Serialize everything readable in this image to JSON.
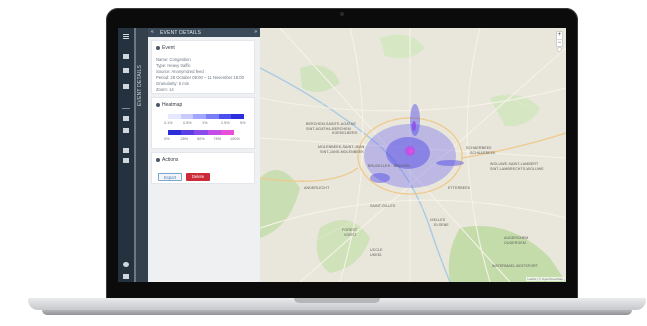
{
  "sidebar": {
    "header_title": "EVENT DETAILS",
    "back_glyph": "«",
    "close_glyph": "»",
    "vertical_label": "EVENT DETAILS"
  },
  "event_card": {
    "title": "Event",
    "rows": [
      "Name: Congestion",
      "Type: Heavy traffic",
      "Source: Anonymized feed",
      "Period: 28 October 09:00 – 11 November 18:00",
      "Granularity: 5 min",
      "Zoom: 14"
    ]
  },
  "heatmap_card": {
    "title": "Heatmap",
    "row1_labels": [
      "0.1%",
      "0.5%",
      "1%",
      "2.5%",
      "5%"
    ],
    "row2_labels": [
      "0%",
      "25%",
      "50%",
      "75%",
      "100%"
    ],
    "row1_colors": [
      "#e6e8ff",
      "#c9cbff",
      "#a3a6ff",
      "#7b7ff5",
      "#4a4ff0",
      "#2c2ee0"
    ],
    "row2_colors": [
      "#2b2ed8",
      "#5a3ee6",
      "#8b4bea",
      "#c24ee8",
      "#e84ed6"
    ]
  },
  "actions_card": {
    "title": "Actions",
    "export_label": "Export",
    "delete_label": "Delete"
  },
  "map": {
    "labels": [
      "BERCHEM-SAINTE-AGATHE",
      "SINT-AGATHA-BERCHEM",
      "KOEKELBERG",
      "MOLENBEEK-SAINT-JEAN",
      "SINT-JANS-MOLENBEEK",
      "BRUXELLES · BRUSSEL",
      "SCHAERBEEK",
      "SCHAARBEEK",
      "WOLUWE-SAINT-LAMBERT",
      "SINT-LAMBRECHTS-WOLUWE",
      "ANDERLECHT",
      "ETTERBEEK",
      "IXELLES",
      "ELSENE",
      "SAINT-GILLES",
      "FOREST",
      "VORST",
      "UCCLE",
      "UKKEL",
      "AUDERGHEM",
      "OUDERGEM",
      "WATERMAEL-BOITSFORT"
    ],
    "zoom_in": "+",
    "zoom_out": "−",
    "attribution": "Leaflet | © OpenStreetMap"
  }
}
